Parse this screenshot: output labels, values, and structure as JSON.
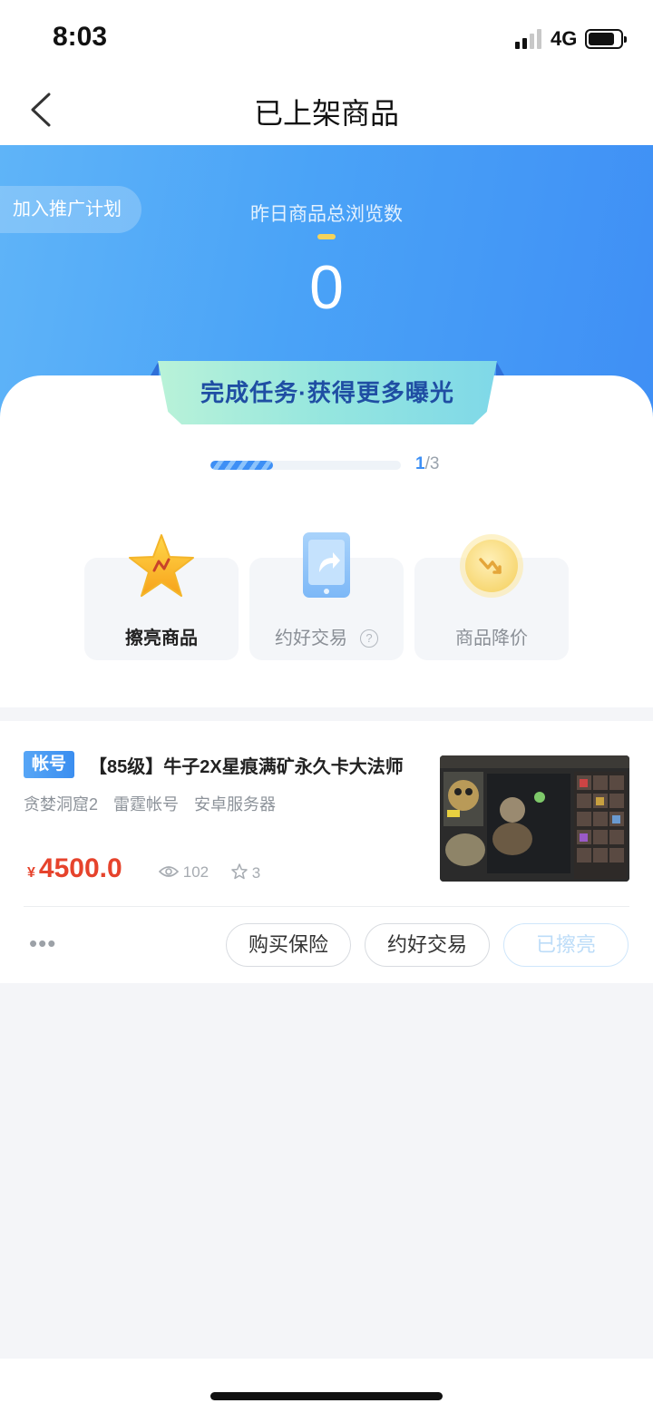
{
  "status": {
    "time": "8:03",
    "network": "4G"
  },
  "nav": {
    "title": "已上架商品"
  },
  "hero": {
    "promo_label": "加入推广计划",
    "views_label": "昨日商品总浏览数",
    "views_value": "0"
  },
  "tasks": {
    "banner": "完成任务·获得更多曝光",
    "progress_current": "1",
    "progress_total": "/3",
    "progress_fraction": 0.33,
    "items": [
      {
        "label": "擦亮商品",
        "icon": "star-icon"
      },
      {
        "label": "约好交易",
        "icon": "phone-share-icon",
        "help": "?"
      },
      {
        "label": "商品降价",
        "icon": "price-down-coin-icon"
      }
    ]
  },
  "listing": {
    "badge": "帐号",
    "title": "【85级】牛子2X星痕满矿永久卡大法师",
    "tags": [
      "贪婪洞窟2",
      "雷霆帐号",
      "安卓服务器"
    ],
    "currency": "¥",
    "price": "4500.0",
    "views": "102",
    "favorites": "3",
    "more": "•••",
    "actions": {
      "insurance": "购买保险",
      "appointment": "约好交易",
      "polished": "已擦亮"
    }
  },
  "colors": {
    "accent": "#3d8ff5",
    "price": "#e6432c",
    "banner_text": "#1f4ea3"
  }
}
